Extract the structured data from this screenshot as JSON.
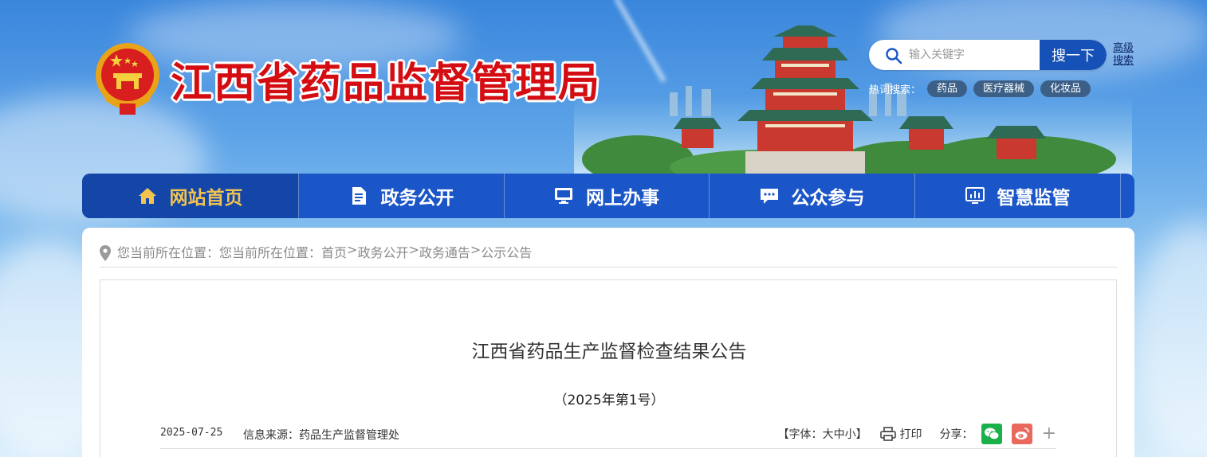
{
  "header": {
    "site_title": "江西省药品监督管理局"
  },
  "search": {
    "placeholder": "输入关键字",
    "button_label": "搜一下",
    "advanced_label": "高级搜索",
    "hot_label": "热词搜索：",
    "hot_tags": [
      "药品",
      "医疗器械",
      "化妆品"
    ]
  },
  "nav": {
    "items": [
      {
        "label": "网站首页",
        "icon": "home-icon",
        "active": true
      },
      {
        "label": "政务公开",
        "icon": "document-icon",
        "active": false
      },
      {
        "label": "网上办事",
        "icon": "monitor-icon",
        "active": false
      },
      {
        "label": "公众参与",
        "icon": "chat-icon",
        "active": false
      },
      {
        "label": "智慧监管",
        "icon": "dashboard-icon",
        "active": false
      }
    ]
  },
  "breadcrumb": {
    "prefix": "您当前所在位置：您当前所在位置：",
    "items": [
      "首页",
      "政务公开",
      "政务通告",
      "公示公告"
    ],
    "separator": ">"
  },
  "article": {
    "title": "江西省药品生产监督检查结果公告",
    "subtitle": "（2025年第1号）",
    "date": "2025-07-25",
    "source_label": "信息来源：药品生产监督管理处",
    "font_prefix": "【字体：",
    "font_large": "大",
    "font_medium": "中",
    "font_small": "小",
    "font_suffix": "】",
    "print_label": "打印",
    "share_label": "分享：",
    "share_more": "+"
  },
  "colors": {
    "title_red": "#d40d12",
    "nav_blue": "#1b56c8",
    "nav_active_bg": "#1446a8",
    "nav_active_text": "#f3c350",
    "search_button": "#1651b8"
  }
}
